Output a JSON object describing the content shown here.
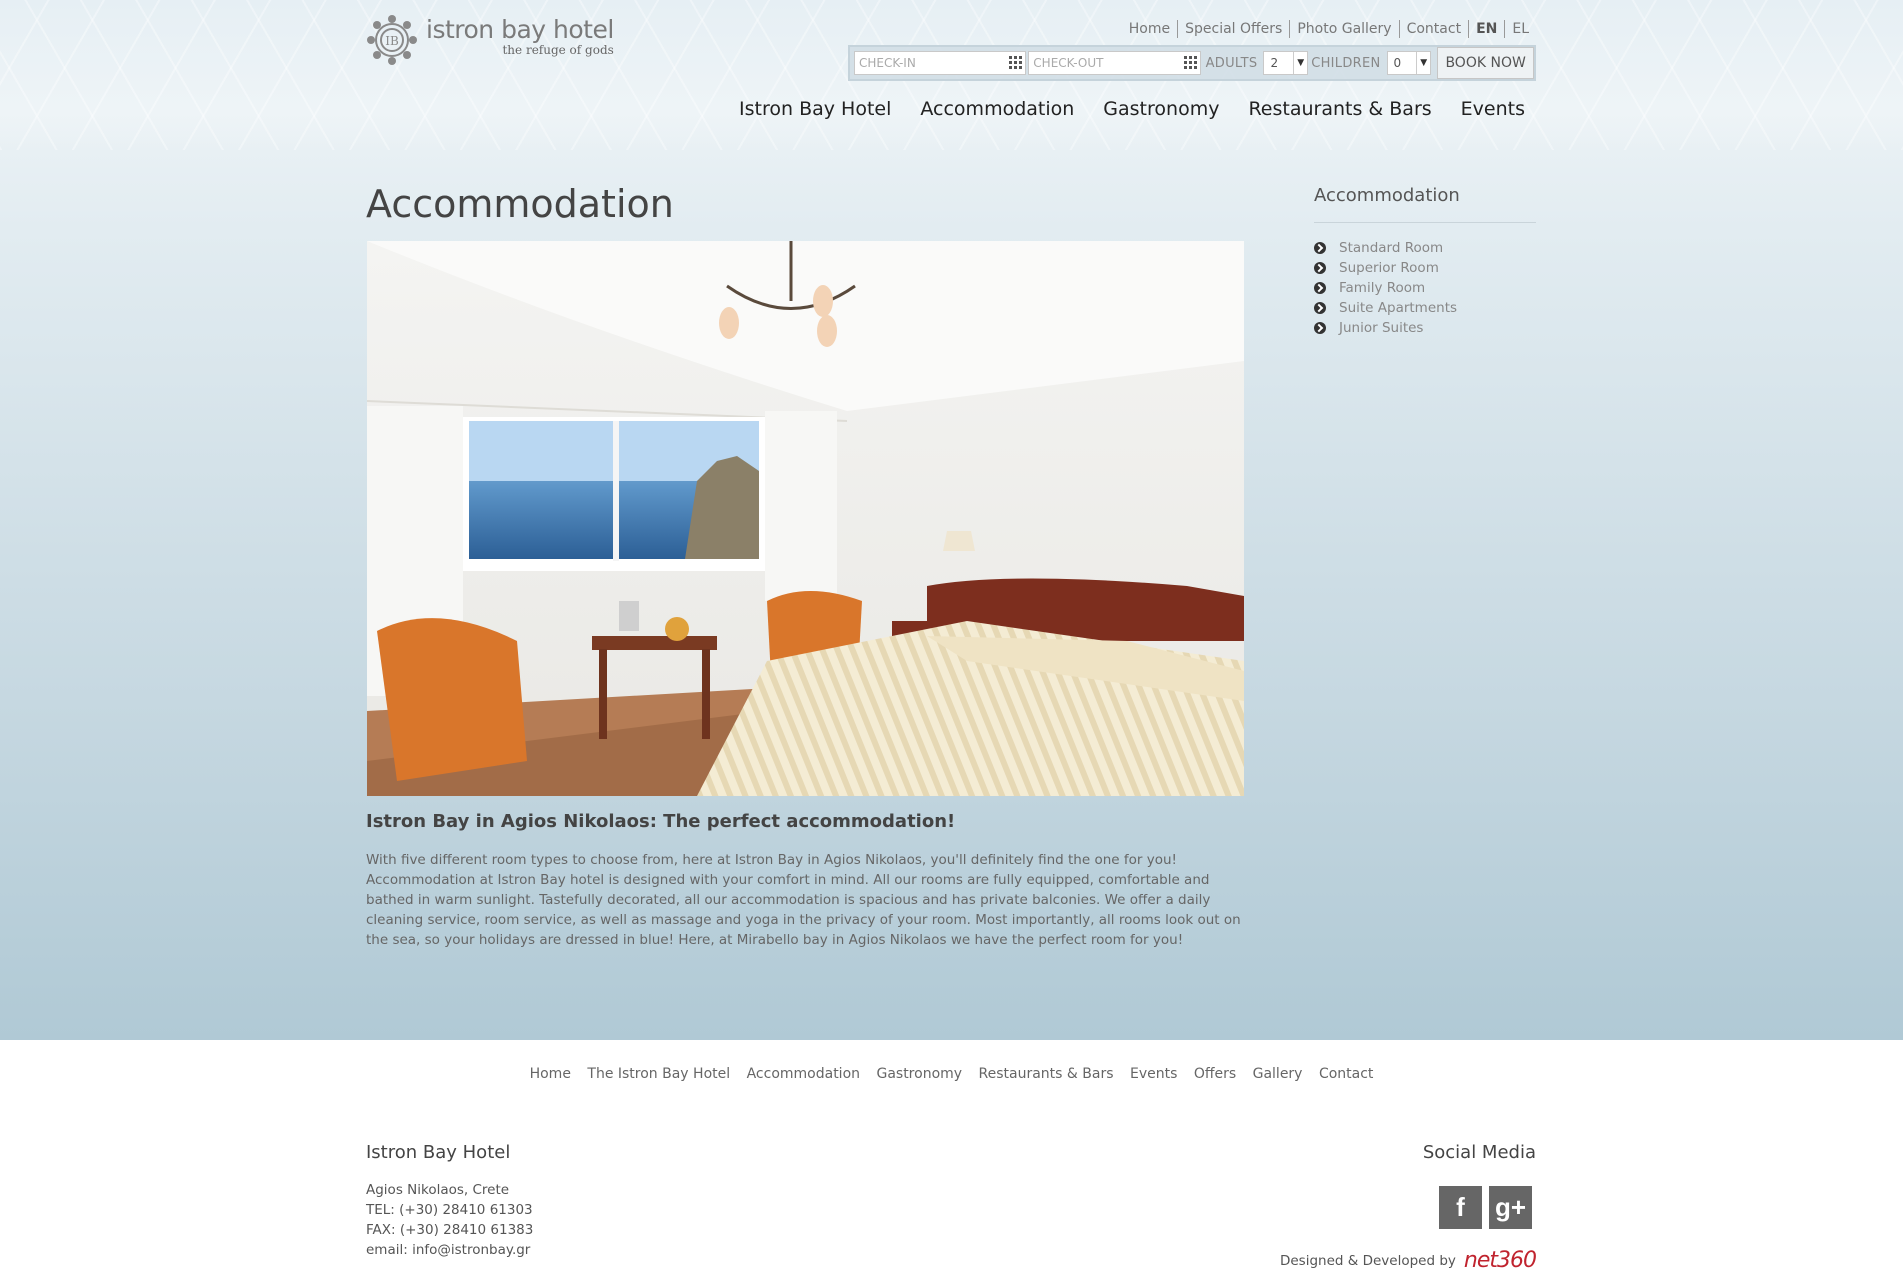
{
  "brand": {
    "name": "istron bay hotel",
    "tagline": "the refuge of gods"
  },
  "toplinks": [
    "Home",
    "Special Offers",
    "Photo Gallery",
    "Contact"
  ],
  "languages": {
    "active": "EN",
    "other": "EL"
  },
  "booking": {
    "checkin_placeholder": "CHECK-IN",
    "checkout_placeholder": "CHECK-OUT",
    "adults_label": "ADULTS",
    "adults_value": "2",
    "children_label": "CHILDREN",
    "children_value": "0",
    "book_label": "BOOK NOW"
  },
  "mainnav": [
    "Istron Bay Hotel",
    "Accommodation",
    "Gastronomy",
    "Restaurants & Bars",
    "Events"
  ],
  "page": {
    "title": "Accommodation",
    "subtitle": "Istron Bay in Agios Nikolaos: The perfect accommodation!",
    "body": "With five different room types to choose from, here at Istron Bay in Agios Nikolaos, you'll definitely find the one for you! Accommodation at Istron Bay hotel is designed with your comfort in mind. All our rooms are fully equipped, comfortable and bathed in warm sunlight. Tastefully decorated, all our accommodation is spacious and has private balconies. We offer a daily cleaning service, room service, as well as massage and yoga in the privacy of your room. Most importantly, all rooms look out on the sea, so your holidays are dressed in blue! Here, at Mirabello bay in Agios Nikolaos we have the perfect room for you!"
  },
  "sidebar": {
    "title": "Accommodation",
    "items": [
      "Standard Room",
      "Superior Room",
      "Family Room",
      "Suite Apartments",
      "Junior Suites"
    ]
  },
  "footer": {
    "links": [
      "Home",
      "The Istron Bay Hotel",
      "Accommodation",
      "Gastronomy",
      "Restaurants & Bars",
      "Events",
      "Offers",
      "Gallery",
      "Contact"
    ],
    "hotel_title": "Istron Bay Hotel",
    "address": "Agios Nikolaos, Crete",
    "tel": "TEL: (+30) 28410 61303",
    "fax": "FAX: (+30) 28410 61383",
    "email": "email: info@istronbay.gr",
    "social_title": "Social Media",
    "social": [
      {
        "icon": "facebook-icon",
        "glyph": "f"
      },
      {
        "icon": "google-plus-icon",
        "glyph": "g+"
      }
    ],
    "credit_text": "Designed & Developed by",
    "credit_logo": "net360"
  }
}
